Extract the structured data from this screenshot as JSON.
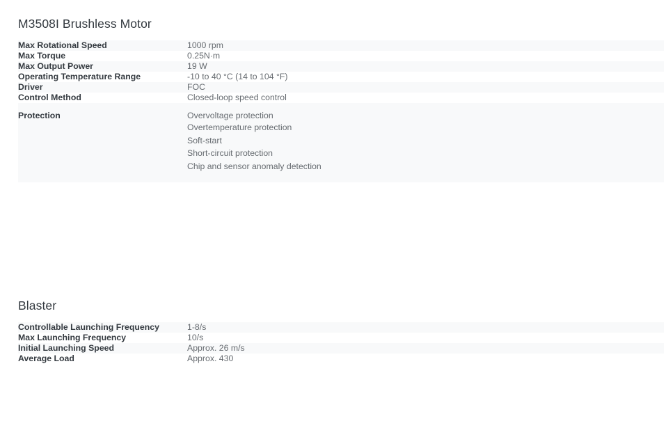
{
  "sections": [
    {
      "id": "motor",
      "title": "M3508I Brushless Motor",
      "rows": [
        {
          "label": "Max Rotational Speed",
          "value": "1000 rpm"
        },
        {
          "label": "Max Torque",
          "value": "0.25N·m"
        },
        {
          "label": "Max Output Power",
          "value": "19 W"
        },
        {
          "label": "Operating Temperature Range",
          "value": "-10 to 40 °C (14 to 104 °F)"
        },
        {
          "label": "Driver",
          "value": "FOC"
        },
        {
          "label": "Control Method",
          "value": "Closed-loop speed control"
        },
        {
          "label": "Protection",
          "value": "",
          "lines": [
            "Overvoltage protection",
            "Overtemperature protection",
            "Soft-start",
            "Short-circuit protection",
            "Chip and sensor anomaly detection"
          ]
        }
      ]
    },
    {
      "id": "blaster",
      "title": "Blaster",
      "rows": [
        {
          "label": "Controllable Launching Frequency",
          "value": "1-8/s"
        },
        {
          "label": "Max Launching Frequency",
          "value": "10/s"
        },
        {
          "label": "Initial Launching Speed",
          "value": "Approx. 26 m/s"
        },
        {
          "label": "Average Load",
          "value": "Approx. 430"
        }
      ]
    }
  ],
  "colors": {
    "page_background": "#ffffff",
    "row_stripe": "#f8f9fa",
    "label_text": "#343a40",
    "value_text": "#666b70",
    "heading_text": "#343a40"
  }
}
